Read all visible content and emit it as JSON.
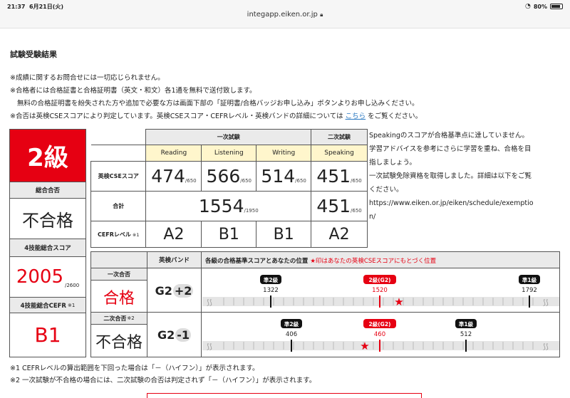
{
  "status_bar": {
    "time": "21:37",
    "date": "6月21日(火)",
    "url": "integapp.eiken.or.jp",
    "battery": "80%"
  },
  "page_title": "試験受験結果",
  "notes": {
    "line1": "※成績に関するお問合せには一切応じられません。",
    "line2": "※合格者には合格証書と合格証明書（英文・和文）各1通を無料で送付致します。",
    "line3": "無料の合格証明書を紛失された方や追加で必要な方は画面下部の「証明書/合格バッジお申し込み」ボタンよりお申し込みください。",
    "line4_pre": "※合否は英検CSEスコアにより判定しています。英検CSEスコア・CEFRレベル・英検バンドの詳細については",
    "link": "こちら",
    "line4_post": "をご覧ください。"
  },
  "left": {
    "grade": "2級",
    "overall_label": "総合合否",
    "overall_value": "不合格",
    "total_label": "4技能総合スコア",
    "total_value": "2005",
    "total_max": "/2600",
    "cefr_label": "4技能総合CEFR",
    "cefr_note": "※1",
    "cefr_value": "B1"
  },
  "score_table": {
    "first_stage": "一次試験",
    "second_stage": "二次試験",
    "skills": [
      "Reading",
      "Listening",
      "Writing",
      "Speaking"
    ],
    "cse_label": "英検CSEスコア",
    "scores": [
      {
        "value": "474",
        "max": "/650"
      },
      {
        "value": "566",
        "max": "/650"
      },
      {
        "value": "514",
        "max": "/650"
      },
      {
        "value": "451",
        "max": "/650"
      }
    ],
    "total_label": "合計",
    "first_total": "1554",
    "first_total_max": "/1950",
    "second_total": "451",
    "second_total_max": "/650",
    "cefr_label": "CEFRレベル",
    "cefr_note": "※1",
    "cefr": [
      "A2",
      "B1",
      "B1",
      "A2"
    ]
  },
  "speaking_comment": {
    "line1": "Speakingのスコアが合格基準点に達していません。",
    "line2": "学習アドバイスを参考にさらに学習を重ね、合格を目",
    "line3": "指しましょう。",
    "line4": "一次試験免除資格を取得しました。詳細は以下をご覧",
    "line5": "ください。",
    "line6": "https://www.eiken.or.jp/eiken/schedule/exemptio",
    "line7": "n/"
  },
  "band": {
    "header_band": "英検バンド",
    "header_title": "各級の合格基準スコアとあなたの位置",
    "header_note": "★印はあなたの英検CSEスコアにもとづく位置",
    "first": {
      "label": "一次合否",
      "result": "合格",
      "band_grade": "G2",
      "band_delta": "+2",
      "markers": [
        {
          "grade": "準2級",
          "score": "1322"
        },
        {
          "grade": "2級(G2)",
          "score": "1520"
        },
        {
          "grade": "準1級",
          "score": "1792"
        }
      ]
    },
    "second": {
      "label": "二次合否",
      "note": "※2",
      "result": "不合格",
      "band_grade": "G2",
      "band_delta": "-1",
      "markers": [
        {
          "grade": "準2級",
          "score": "406"
        },
        {
          "grade": "2級(G2)",
          "score": "460"
        },
        {
          "grade": "準1級",
          "score": "512"
        }
      ]
    }
  },
  "footnotes": {
    "fn1": "※1 CEFRレベルの算出範囲を下回った場合は「－（ハイフン）」が表示されます。",
    "fn2": "※2 一次試験が不合格の場合には、二次試験の合否は判定されず「－（ハイフン）」が表示されます。"
  },
  "colors": {
    "accent_red": "#e60012",
    "link_blue": "#2a79c2",
    "header_gray": "#eaeaea",
    "skill_yellow": "#fff6cc"
  }
}
